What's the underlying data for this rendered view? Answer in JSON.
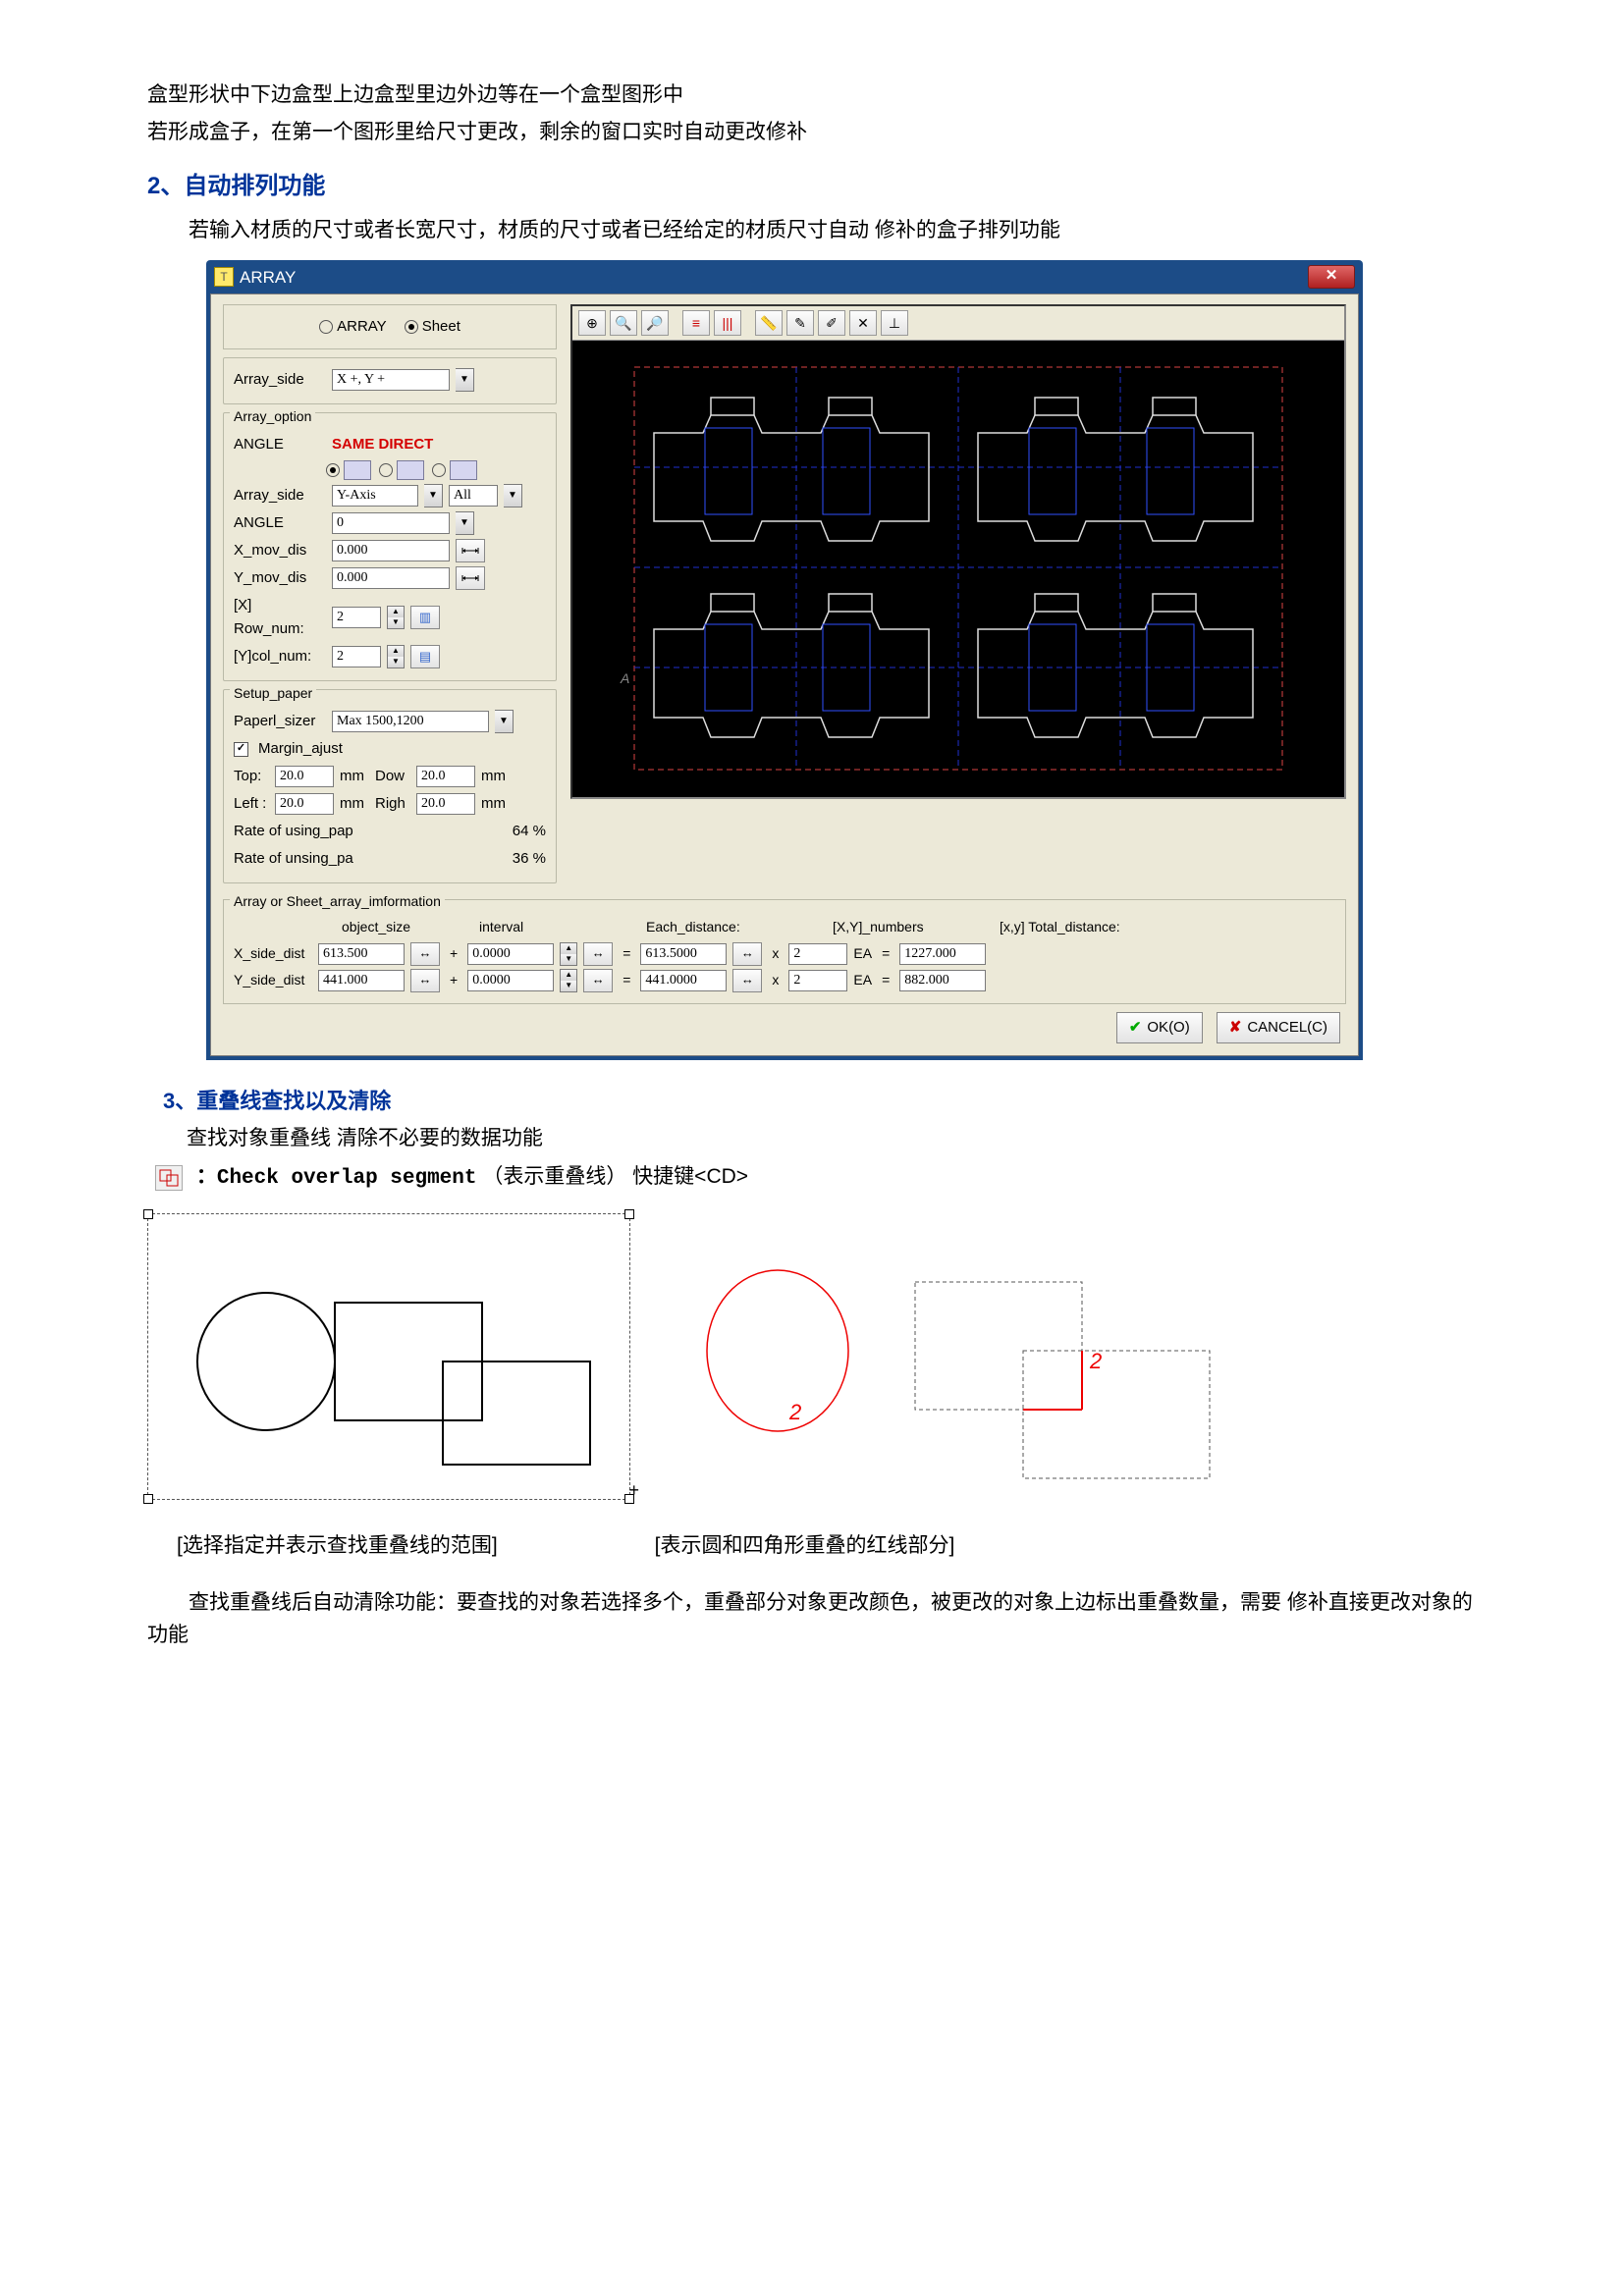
{
  "intro": {
    "line1": "盒型形状中下边盒型上边盒型里边外边等在一个盒型图形中",
    "line2": "若形成盒子，在第一个图形里给尺寸更改，剩余的窗口实时自动更改修补"
  },
  "sec2": {
    "heading": "2、自动排列功能",
    "body": "若输入材质的尺寸或者长宽尺寸，材质的尺寸或者已经给定的材质尺寸自动 修补的盒子排列功能"
  },
  "dlg": {
    "title": "ARRAY",
    "radio_array": "ARRAY",
    "radio_sheet": "Sheet",
    "array_side_lbl": "Array_side",
    "array_side_val": "X +, Y +",
    "grp_option": "Array_option",
    "angle_lbl": "ANGLE",
    "same_direct": "SAME DIRECT",
    "array_side2_lbl": "Array_side",
    "array_side2_val": "Y-Axis",
    "all_val": "All",
    "angle2_lbl": "ANGLE",
    "angle2_val": "0",
    "xmov_lbl": "X_mov_dis",
    "xmov_val": "0.000",
    "ymov_lbl": "Y_mov_dis",
    "ymov_val": "0.000",
    "rownum_lbl": "[X] Row_num:",
    "rownum_val": "2",
    "colnum_lbl": "[Y]col_num:",
    "colnum_val": "2",
    "grp_setup": "Setup_paper",
    "paper_lbl": "Paperl_sizer",
    "paper_val": "Max 1500,1200",
    "margin_chk": "Margin_ajust",
    "top_lbl": "Top:",
    "top_val": "20.0",
    "dow_lbl": "Dow",
    "dow_val": "20.0",
    "left_lbl": "Left :",
    "left_val": "20.0",
    "right_lbl": "Righ",
    "right_val": "20.0",
    "mm": "mm",
    "rate_using": "Rate of using_pap",
    "rate_using_v": "64 %",
    "rate_unsing": "Rate of unsing_pa",
    "rate_unsing_v": "36 %",
    "grp_info": "Array or Sheet_array_imformation",
    "h_obj": "object_size",
    "h_int": "interval",
    "h_each": "Each_distance:",
    "h_xy": "[X,Y]_numbers",
    "h_total": "[x,y] Total_distance:",
    "xside_lbl": "X_side_dist",
    "xside_obj": "613.500",
    "xside_int": "0.0000",
    "xside_each": "613.5000",
    "xside_n": "2",
    "xside_tot": "1227.000",
    "yside_lbl": "Y_side_dist",
    "yside_obj": "441.000",
    "yside_int": "0.0000",
    "yside_each": "441.0000",
    "yside_n": "2",
    "yside_tot": "882.000",
    "ea": "EA",
    "ok": "OK(O)",
    "cancel": "CANCEL(C)"
  },
  "sec3": {
    "heading": "3、重叠线查找以及清除",
    "body": "查找对象重叠线 清除不必要的数据功能",
    "tool_label": "：Check overlap segment",
    "tool_paren": "（表示重叠线） 快捷键<CD>",
    "cap1": "[选择指定并表示查找重叠线的范围]",
    "cap2": "[表示圆和四角形重叠的红线部分]",
    "two": "2",
    "after": "查找重叠线后自动清除功能：要查找的对象若选择多个，重叠部分对象更改颜色，被更改的对象上边标出重叠数量，需要 修补直接更改对象的功能"
  }
}
